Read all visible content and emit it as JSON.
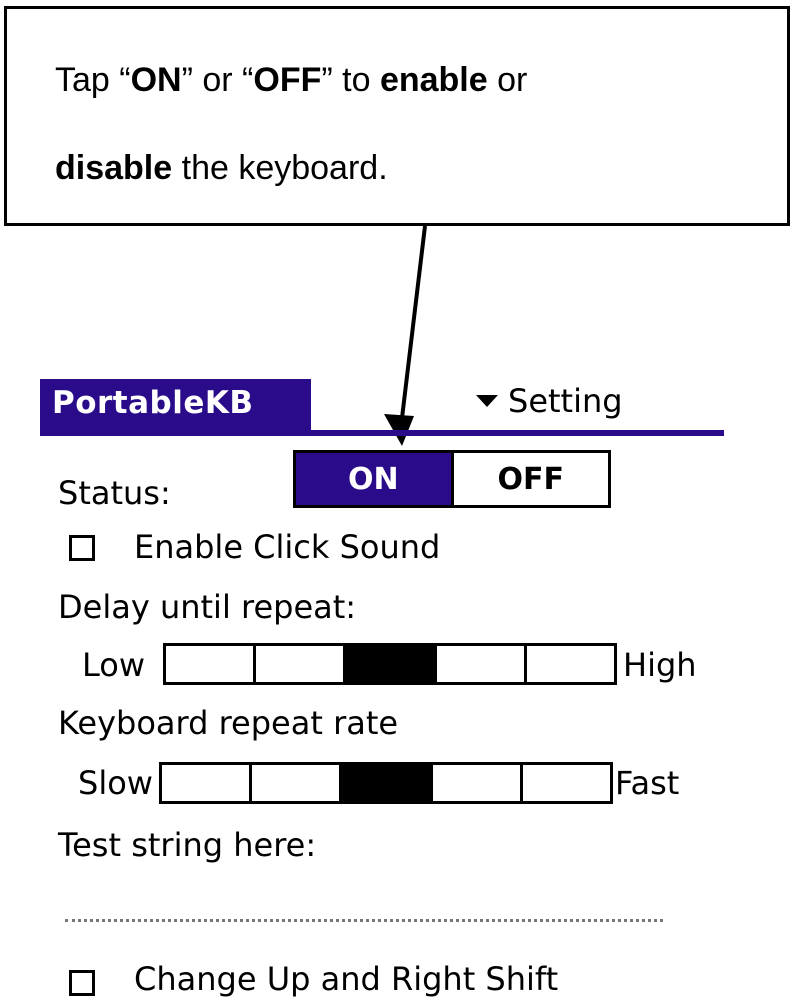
{
  "callout": {
    "t1": "Tap “",
    "b1": "ON",
    "t2": "” or “",
    "b2": "OFF",
    "t3": "” to ",
    "b3": "enable",
    "t4": " or",
    "b4": "disable",
    "t5": " the keyboard."
  },
  "app": {
    "title": "PortableKB",
    "menu_label": "Setting"
  },
  "status": {
    "label": "Status:",
    "on_label": "ON",
    "off_label": "OFF",
    "selected": "ON"
  },
  "click_sound": {
    "label": "Enable Click Sound",
    "checked": false
  },
  "delay": {
    "label": "Delay until repeat:",
    "low_label": "Low",
    "high_label": "High",
    "segments": 5,
    "selected_index": 3
  },
  "repeat_rate": {
    "label": "Keyboard repeat rate",
    "low_label": "Slow",
    "high_label": "Fast",
    "segments": 5,
    "selected_index": 3
  },
  "test": {
    "label": "Test string here:",
    "value": ""
  },
  "shift": {
    "label": "Change Up and Right Shift",
    "checked": false
  },
  "colors": {
    "accent": "#2a0b8a"
  }
}
